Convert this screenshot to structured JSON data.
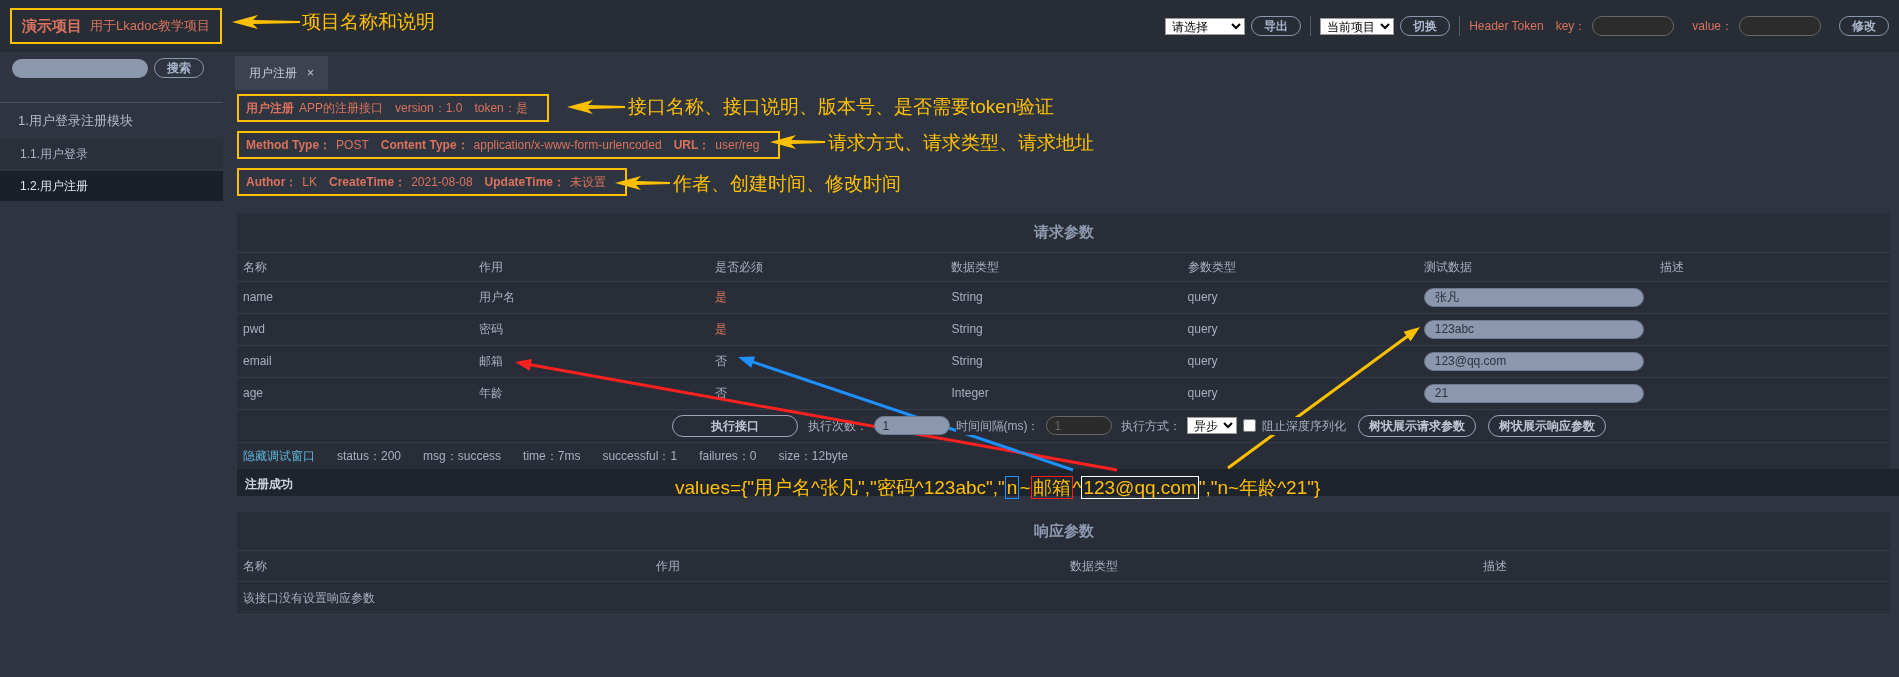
{
  "header": {
    "project_name": "演示项目",
    "project_desc": "用于Lkadoc教学项目",
    "outlined": true,
    "export_select": "请选择",
    "export_button": "导出",
    "project_select": "当前项目",
    "switch_button": "切换",
    "token_label": "Header Token",
    "key_label": "key：",
    "value_label": "value：",
    "modify_button": "修改"
  },
  "sidebar": {
    "search_button": "搜索",
    "modules": [
      {
        "label": "1.用户登录注册模块",
        "children": [
          {
            "label": "1.1.用户登录",
            "selected": false
          },
          {
            "label": "1.2.用户注册",
            "selected": true
          }
        ]
      }
    ]
  },
  "tabs": [
    {
      "label": "用户注册",
      "close": "×",
      "selected": true
    }
  ],
  "info_lines": [
    {
      "outlined": true,
      "parts": [
        {
          "text": "用户注册",
          "bold": true
        },
        {
          "text": "APP的注册接口",
          "bold": false
        },
        {
          "text": "version：1.0",
          "bold": false
        },
        {
          "text": "token：是",
          "bold": false
        }
      ]
    },
    {
      "outlined": true,
      "parts": [
        {
          "text": "Method Type：",
          "bold": true
        },
        {
          "text": "POST",
          "bold": false
        },
        {
          "text": "Content Type：",
          "bold": true
        },
        {
          "text": "application/x-www-form-urlencoded",
          "bold": false
        },
        {
          "text": "URL：",
          "bold": true
        },
        {
          "text": "user/reg",
          "bold": false
        }
      ]
    },
    {
      "outlined": true,
      "parts": [
        {
          "text": "Author：",
          "bold": true
        },
        {
          "text": "LK",
          "bold": false
        },
        {
          "text": "CreateTime：",
          "bold": true
        },
        {
          "text": "2021-08-08",
          "bold": false
        },
        {
          "text": "UpdateTime：",
          "bold": true
        },
        {
          "text": "未设置",
          "bold": false
        }
      ]
    }
  ],
  "request_params": {
    "title": "请求参数",
    "columns": [
      "名称",
      "作用",
      "是否必须",
      "数据类型",
      "参数类型",
      "测试数据",
      "描述"
    ],
    "rows": [
      {
        "cells": [
          "name",
          "用户名",
          "是",
          "String",
          "query"
        ],
        "required": true,
        "test_value": "张凡"
      },
      {
        "cells": [
          "pwd",
          "密码",
          "是",
          "String",
          "query"
        ],
        "required": true,
        "test_value": "123abc"
      },
      {
        "cells": [
          "email",
          "邮箱",
          "否",
          "String",
          "query"
        ],
        "required": false,
        "test_value": "123@qq.com"
      },
      {
        "cells": [
          "age",
          "年龄",
          "否",
          "Integer",
          "query"
        ],
        "required": false,
        "test_value": "21"
      }
    ],
    "run_button": "执行接口",
    "count_label": "执行次数：",
    "count_value": "1",
    "interval_label": "时间间隔(ms)：",
    "interval_value": "1",
    "interval_disabled": true,
    "mode_label": "执行方式：",
    "mode_select": "异步",
    "block_label": "阻止深度序列化",
    "block_checked": false,
    "tree_request_button": "树状展示请求参数",
    "tree_response_button": "树状展示响应参数"
  },
  "debug": {
    "toggle_link": "隐藏调试窗口",
    "items": [
      "status：200",
      "msg：success",
      "time：7ms",
      "successful：1",
      "failures：0",
      "size：12byte"
    ],
    "result": "注册成功"
  },
  "response_params": {
    "title": "响应参数",
    "columns": [
      "名称",
      "作用",
      "数据类型",
      "描述"
    ],
    "empty_text": "该接口没有设置响应参数"
  },
  "annotations": {
    "callouts": [
      {
        "text": "项目名称和说明"
      },
      {
        "text": "接口名称、接口说明、版本号、是否需要token验证"
      },
      {
        "text": "请求方式、请求类型、请求地址"
      },
      {
        "text": "作者、创建时间、修改时间"
      }
    ],
    "values_note": [
      {
        "text": "values={\"用户名^张凡\",\"密码^123abc\",\""
      },
      {
        "text": "n",
        "color": "#1e90ff"
      },
      {
        "text": "~"
      },
      {
        "text": "邮箱",
        "color": "#ff2020"
      },
      {
        "text": "^"
      },
      {
        "text": "123@qq.com",
        "color": "#ffffff"
      },
      {
        "text": "\",\"n~年龄^21\"}"
      }
    ]
  }
}
